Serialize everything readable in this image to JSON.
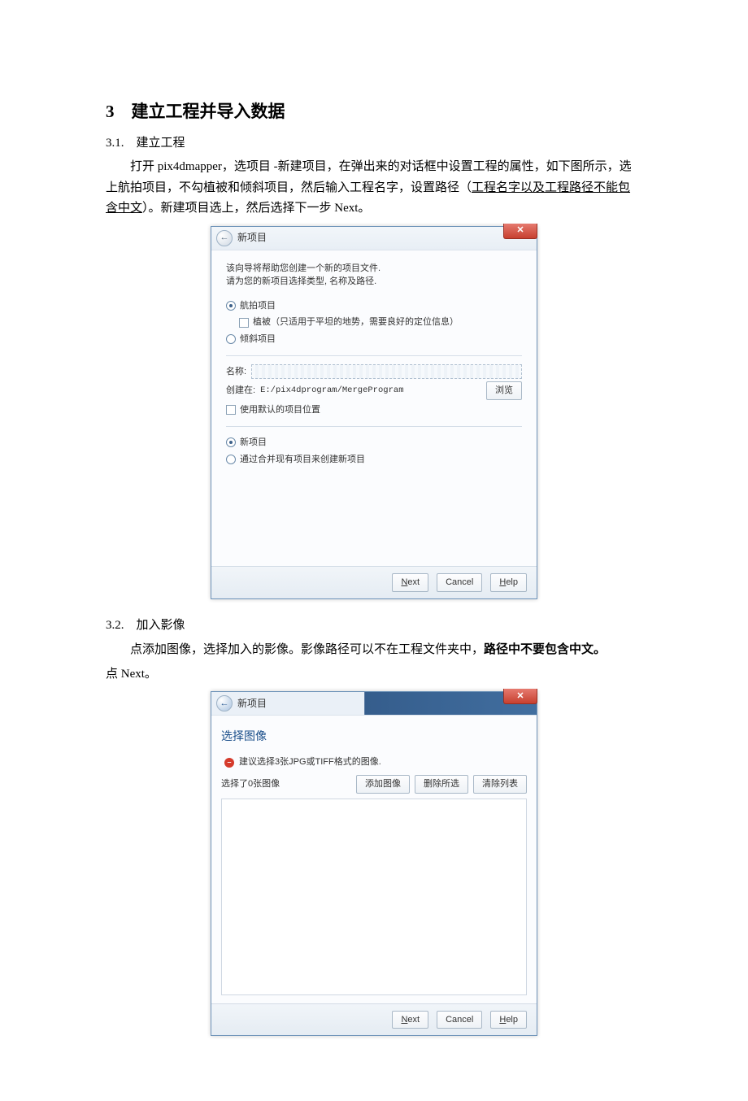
{
  "doc": {
    "section_title": "3　建立工程并导入数据",
    "sub1_title": "3.1.　建立工程",
    "sub1_text_prefix": "打开 pix4dmapper，选项目 -新建项目，在弹出来的对话框中设置工程的属性，如下图所示，选上航拍项目，不勾植被和倾斜项目，然后输入工程名字，设置路径（",
    "sub1_text_underlined": "工程名字以及工程路径不能包含中文",
    "sub1_text_suffix": "）。新建项目选上，然后选择下一步 Next。",
    "sub2_title": "3.2.　加入影像",
    "sub2_text_prefix": "点添加图像，选择加入的影像。影像路径可以不在工程文件夹中，",
    "sub2_text_bold": "路径中不要包含中文。",
    "sub2_text_suffix": "点 Next。"
  },
  "dlg1": {
    "title": "新项目",
    "intro_line1": "该向导将帮助您创建一个新的项目文件.",
    "intro_line2": "请为您的新项目选择类型, 名称及路径.",
    "radio_aerial": "航拍项目",
    "check_vegetation": "植被（只适用于平坦的地势，需要良好的定位信息）",
    "radio_oblique": "倾斜项目",
    "name_label": "名称:",
    "create_at_label": "创建在:",
    "create_at_value": "E:/pix4dprogram/MergeProgram",
    "browse": "浏览",
    "use_default": "使用默认的项目位置",
    "radio_new": "新项目",
    "radio_merge": "通过合并现有项目来创建新项目",
    "next": "Next",
    "cancel": "Cancel",
    "help": "Help"
  },
  "dlg2": {
    "title": "新项目",
    "select_images": "选择图像",
    "warning": "建议选择3张JPG或TIFF格式的图像.",
    "status": "选择了0张图像",
    "add_images": "添加图像",
    "delete_selected": "删除所选",
    "clear_list": "清除列表",
    "next": "Next",
    "cancel": "Cancel",
    "help": "Help"
  }
}
